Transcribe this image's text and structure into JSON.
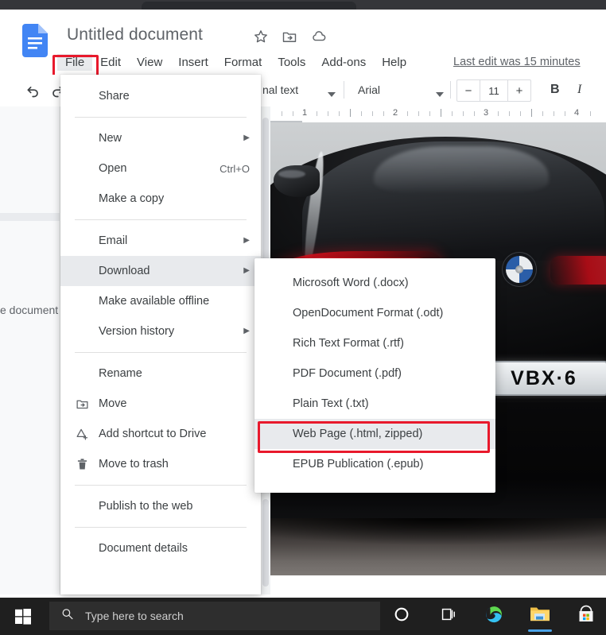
{
  "browser": {
    "tab_active": true
  },
  "docs": {
    "title": "Untitled document",
    "logo_icon": "google-docs-logo",
    "title_icons": [
      "star-icon",
      "move-to-folder-icon",
      "cloud-saved-icon"
    ],
    "menubar": [
      {
        "label": "File",
        "active": true
      },
      {
        "label": "Edit",
        "active": false
      },
      {
        "label": "View",
        "active": false
      },
      {
        "label": "Insert",
        "active": false
      },
      {
        "label": "Format",
        "active": false
      },
      {
        "label": "Tools",
        "active": false
      },
      {
        "label": "Add-ons",
        "active": false
      },
      {
        "label": "Help",
        "active": false
      }
    ],
    "last_edit": "Last edit was 15 minutes"
  },
  "toolbar": {
    "undo_icon": "undo-icon",
    "redo_icon": "redo-icon",
    "paragraph_style": "nal text",
    "font_family": "Arial",
    "font_size": "11",
    "decrease_label": "−",
    "increase_label": "+",
    "bold_label": "B",
    "italic_label": "I"
  },
  "outline": {
    "partial_text": "e document"
  },
  "ruler": {
    "numbers": [
      "1",
      "2",
      "3",
      "4"
    ]
  },
  "document_image": {
    "subject": "black-bmw-car-rear",
    "license_plate": "VBX·6",
    "badge": "bmw-roundel-icon"
  },
  "file_menu": {
    "items": [
      {
        "label": "Share",
        "icon": null,
        "shortcut": null,
        "arrow": false,
        "highlight": false,
        "sep_after": true
      },
      {
        "label": "New",
        "icon": null,
        "shortcut": null,
        "arrow": true,
        "highlight": false,
        "sep_after": false
      },
      {
        "label": "Open",
        "icon": null,
        "shortcut": "Ctrl+O",
        "arrow": false,
        "highlight": false,
        "sep_after": false
      },
      {
        "label": "Make a copy",
        "icon": null,
        "shortcut": null,
        "arrow": false,
        "highlight": false,
        "sep_after": true
      },
      {
        "label": "Email",
        "icon": null,
        "shortcut": null,
        "arrow": true,
        "highlight": false,
        "sep_after": false
      },
      {
        "label": "Download",
        "icon": null,
        "shortcut": null,
        "arrow": true,
        "highlight": true,
        "sep_after": false
      },
      {
        "label": "Make available offline",
        "icon": null,
        "shortcut": null,
        "arrow": false,
        "highlight": false,
        "sep_after": false
      },
      {
        "label": "Version history",
        "icon": null,
        "shortcut": null,
        "arrow": true,
        "highlight": false,
        "sep_after": true
      },
      {
        "label": "Rename",
        "icon": null,
        "shortcut": null,
        "arrow": false,
        "highlight": false,
        "sep_after": false
      },
      {
        "label": "Move",
        "icon": "move-folder-icon",
        "shortcut": null,
        "arrow": false,
        "highlight": false,
        "sep_after": false
      },
      {
        "label": "Add shortcut to Drive",
        "icon": "add-shortcut-icon",
        "shortcut": null,
        "arrow": false,
        "highlight": false,
        "sep_after": false
      },
      {
        "label": "Move to trash",
        "icon": "trash-icon",
        "shortcut": null,
        "arrow": false,
        "highlight": false,
        "sep_after": true
      },
      {
        "label": "Publish to the web",
        "icon": null,
        "shortcut": null,
        "arrow": false,
        "highlight": false,
        "sep_after": true
      },
      {
        "label": "Document details",
        "icon": null,
        "shortcut": null,
        "arrow": false,
        "highlight": false,
        "sep_after": false
      }
    ]
  },
  "download_menu": {
    "items": [
      {
        "label": "Microsoft Word (.docx)",
        "highlight": false
      },
      {
        "label": "OpenDocument Format (.odt)",
        "highlight": false
      },
      {
        "label": "Rich Text Format (.rtf)",
        "highlight": false
      },
      {
        "label": "PDF Document (.pdf)",
        "highlight": false
      },
      {
        "label": "Plain Text (.txt)",
        "highlight": false
      },
      {
        "label": "Web Page (.html, zipped)",
        "highlight": true
      },
      {
        "label": "EPUB Publication (.epub)",
        "highlight": false
      }
    ]
  },
  "annotations": {
    "color": "#e8192c",
    "boxes": [
      "file-menu-button",
      "web-page-html-zipped-option"
    ]
  },
  "taskbar": {
    "start_icon": "windows-start-icon",
    "search_placeholder": "Type here to search",
    "search_icon": "search-icon",
    "icons": [
      {
        "name": "cortana-icon",
        "active": false
      },
      {
        "name": "task-view-icon",
        "active": false
      },
      {
        "name": "microsoft-edge-icon",
        "active": false
      },
      {
        "name": "file-explorer-icon",
        "active": true
      },
      {
        "name": "microsoft-store-icon",
        "active": false
      }
    ]
  }
}
